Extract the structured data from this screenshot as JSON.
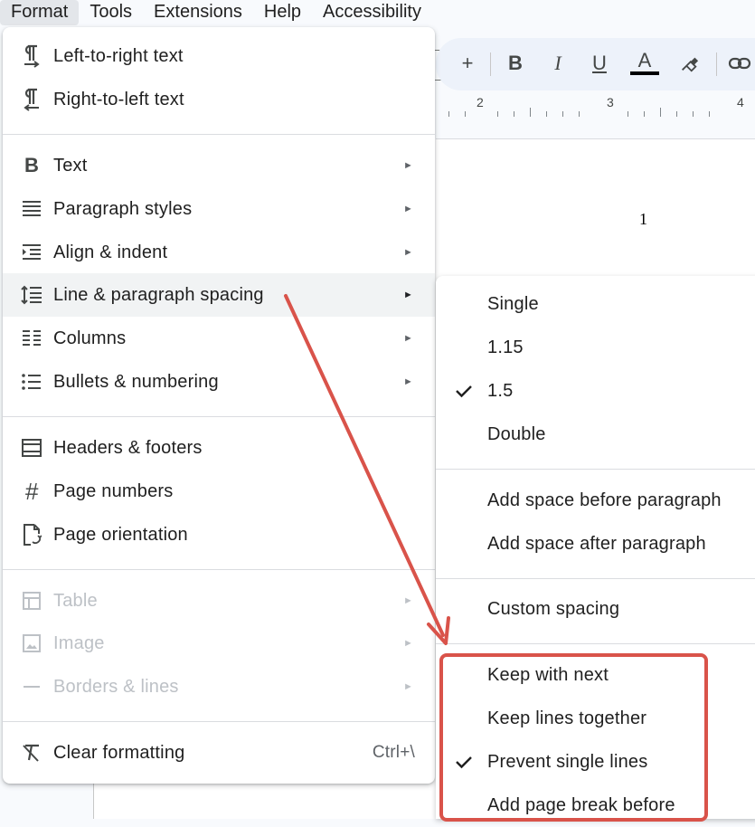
{
  "menubar": {
    "items": [
      "Format",
      "Tools",
      "Extensions",
      "Help",
      "Accessibility"
    ]
  },
  "toolbar": {
    "buttons": [
      "+",
      "B",
      "I",
      "U",
      "A"
    ]
  },
  "ruler": {
    "numbers": [
      "2",
      "3",
      "4"
    ]
  },
  "document": {
    "page_number": "1"
  },
  "format_menu": {
    "items": [
      {
        "label": "Left-to-right text",
        "icon": "ltr-text-icon"
      },
      {
        "label": "Right-to-left text",
        "icon": "rtl-text-icon"
      },
      {
        "label": "Text",
        "icon": "bold-icon",
        "submenu": true
      },
      {
        "label": "Paragraph styles",
        "icon": "paragraph-styles-icon",
        "submenu": true
      },
      {
        "label": "Align & indent",
        "icon": "indent-icon",
        "submenu": true
      },
      {
        "label": "Line & paragraph spacing",
        "icon": "line-spacing-icon",
        "submenu": true,
        "highlighted": true
      },
      {
        "label": "Columns",
        "icon": "columns-icon",
        "submenu": true
      },
      {
        "label": "Bullets & numbering",
        "icon": "bullets-icon",
        "submenu": true
      },
      {
        "label": "Headers & footers",
        "icon": "header-footer-icon"
      },
      {
        "label": "Page numbers",
        "icon": "hash-icon"
      },
      {
        "label": "Page orientation",
        "icon": "page-orientation-icon"
      },
      {
        "label": "Table",
        "icon": "table-icon",
        "submenu": true,
        "disabled": true
      },
      {
        "label": "Image",
        "icon": "image-icon",
        "submenu": true,
        "disabled": true
      },
      {
        "label": "Borders & lines",
        "icon": "borders-icon",
        "submenu": true,
        "disabled": true
      },
      {
        "label": "Clear formatting",
        "icon": "clear-formatting-icon",
        "shortcut": "Ctrl+\\"
      }
    ]
  },
  "spacing_submenu": {
    "items": [
      {
        "label": "Single",
        "checked": false
      },
      {
        "label": "1.15",
        "checked": false
      },
      {
        "label": "1.5",
        "checked": true
      },
      {
        "label": "Double",
        "checked": false
      },
      {
        "label": "Add space before paragraph",
        "checked": false
      },
      {
        "label": "Add space after paragraph",
        "checked": false
      },
      {
        "label": "Custom spacing",
        "checked": false
      },
      {
        "label": "Keep with next",
        "checked": false
      },
      {
        "label": "Keep lines together",
        "checked": false
      },
      {
        "label": "Prevent single lines",
        "checked": true
      },
      {
        "label": "Add page break before",
        "checked": false
      }
    ]
  },
  "colors": {
    "annotation": "#d9534a",
    "menu_highlight": "#f1f3f4",
    "disabled_text": "#bdc1c6"
  }
}
